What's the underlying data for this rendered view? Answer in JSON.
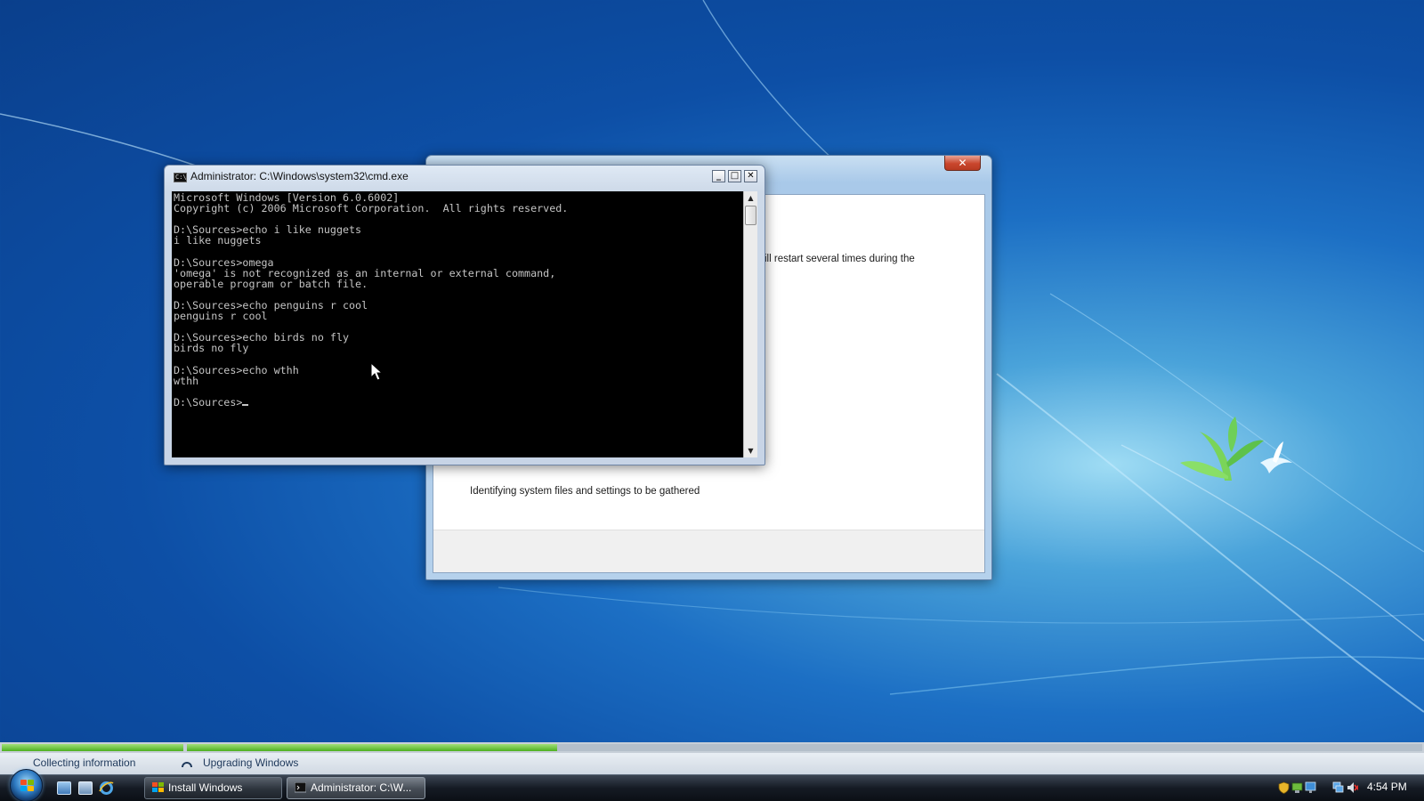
{
  "setup_window": {
    "body_text": "ill restart several times during the",
    "status_text": "Identifying system files and settings to be gathered",
    "close_glyph": "✕"
  },
  "cmd_window": {
    "title": "Administrator: C:\\Windows\\system32\\cmd.exe",
    "icon_text": "C:\\",
    "minimize_glyph": "_",
    "maximize_glyph": "□",
    "close_glyph": "✕",
    "scroll_up_glyph": "▲",
    "scroll_down_glyph": "▼",
    "lines": [
      "Microsoft Windows [Version 6.0.6002]",
      "Copyright (c) 2006 Microsoft Corporation.  All rights reserved.",
      "",
      "D:\\Sources>echo i like nuggets",
      "i like nuggets",
      "",
      "D:\\Sources>omega",
      "'omega' is not recognized as an internal or external command,",
      "operable program or batch file.",
      "",
      "D:\\Sources>echo penguins r cool",
      "penguins r cool",
      "",
      "D:\\Sources>echo birds no fly",
      "birds no fly",
      "",
      "D:\\Sources>echo wthh",
      "wthh",
      ""
    ],
    "prompt": "D:\\Sources>"
  },
  "setup_progress": {
    "stages": [
      {
        "label": "Collecting information",
        "completed_fraction": 1.0
      },
      {
        "label": "Upgrading Windows",
        "completed_fraction": 0.3
      }
    ]
  },
  "taskbar": {
    "tasks": [
      {
        "label": "Install Windows",
        "active": false
      },
      {
        "label": "Administrator: C:\\W...",
        "active": true
      }
    ],
    "quick_launch": [
      "show-desktop-icon",
      "window-switcher-icon",
      "internet-explorer-icon"
    ],
    "tray_icons": [
      "security-shield-icon",
      "network-status-icon",
      "display-icon",
      "network-icon",
      "volume-muted-icon"
    ],
    "clock": "4:54 PM"
  },
  "colors": {
    "desktop_blue": "#0d4fa6",
    "progress_green": "#4db020",
    "terminal_text": "#c4c4c4"
  }
}
